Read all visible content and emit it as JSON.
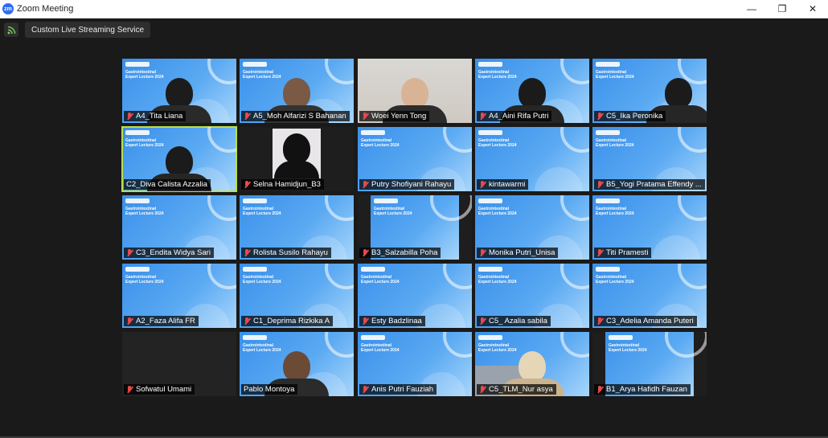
{
  "window": {
    "title": "Zoom Meeting",
    "logo_text": "zm",
    "minimize": "—",
    "restore": "❐",
    "close": "✕"
  },
  "toolbar": {
    "stream_label": "Custom Live Streaming Service"
  },
  "banner": {
    "line1": "Gastrointestinal",
    "line2": "Expert Lecture 2024"
  },
  "participants": [
    {
      "name": "A4_Tita Liana"
    },
    {
      "name": "A5_Moh Alfarizi S Bahanan"
    },
    {
      "name": "Woei Yenn Tong"
    },
    {
      "name": "A4_Aini Rifa Putri"
    },
    {
      "name": "C5_Ika Peronika"
    },
    {
      "name": "C2_Diva Calista Azzalia"
    },
    {
      "name": "Selna Hamidjun_B3"
    },
    {
      "name": "Putry Shofiyani Rahayu"
    },
    {
      "name": "kintawarmi"
    },
    {
      "name": "B5_Yogi Pratama Effendy ..."
    },
    {
      "name": "C3_Endita Widya Sari"
    },
    {
      "name": "Rolista Susilo Rahayu"
    },
    {
      "name": "B3_Salzabilla Poha"
    },
    {
      "name": "Monika Putri_Unisa"
    },
    {
      "name": "Titi Pramesti"
    },
    {
      "name": "A2_Faza Alifa FR"
    },
    {
      "name": "C1_Deprima Rizkika A"
    },
    {
      "name": "Esty Badzlinaa"
    },
    {
      "name": "C5_ Azalia sabila"
    },
    {
      "name": "C3_Adelia Amanda Puteri"
    },
    {
      "name": "Sofwatul Umami"
    },
    {
      "name": "Pablo Montoya"
    },
    {
      "name": "Anis Putri Fauziah"
    },
    {
      "name": "C5_TLM_Nur asya"
    },
    {
      "name": "B1_Arya Hafidh Fauzan"
    }
  ]
}
